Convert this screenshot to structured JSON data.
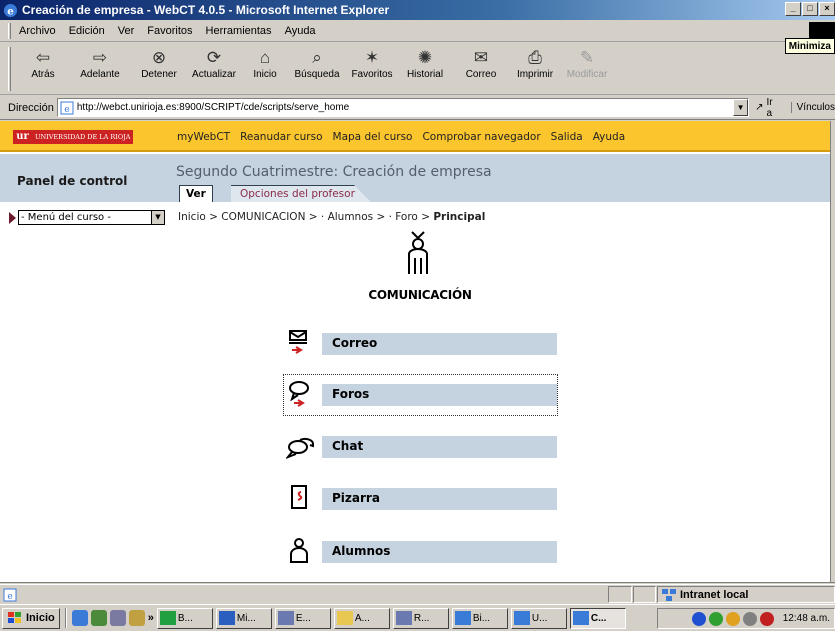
{
  "window": {
    "title": "Creación de empresa - WebCT 4.0.5 - Microsoft Internet Explorer",
    "controls": [
      "_",
      "□",
      "×"
    ]
  },
  "menubar": {
    "items": [
      "Archivo",
      "Edición",
      "Ver",
      "Favoritos",
      "Herramientas",
      "Ayuda"
    ],
    "tooltip": "Minimiza"
  },
  "toolbar": {
    "back": "Atrás",
    "forward": "Adelante",
    "stop": "Detener",
    "refresh": "Actualizar",
    "home": "Inicio",
    "search": "Búsqueda",
    "favorites": "Favoritos",
    "history": "Historial",
    "mail": "Correo",
    "print": "Imprimir",
    "edit": "Modificar"
  },
  "address": {
    "label": "Dirección",
    "url": "http://webct.unirioja.es:8900/SCRIPT/cde/scripts/serve_home",
    "go": "Ir a",
    "links": "Vínculos"
  },
  "webct": {
    "university": "UNIVERSIDAD DE LA RIOJA",
    "university_mark": "ur",
    "nav": [
      "myWebCT",
      "Reanudar curso",
      "Mapa del curso",
      "Comprobar navegador",
      "Salida",
      "Ayuda"
    ],
    "panel_title": "Panel de control",
    "course_title": "Segundo Cuatrimestre: Creación de empresa",
    "tabs": {
      "view": "Ver",
      "teacher": "Opciones del profesor"
    },
    "course_menu": "- Menú del curso -",
    "breadcrumb": {
      "path": "Inicio > COMUNICACION > · Alumnos > · Foro > ",
      "current": "Principal"
    },
    "section_title": "COMUNICACIÓN",
    "items": [
      {
        "label": "Correo",
        "icon": "mail-icon"
      },
      {
        "label": "Foros",
        "icon": "forum-icon"
      },
      {
        "label": "Chat",
        "icon": "chat-icon"
      },
      {
        "label": "Pizarra",
        "icon": "whiteboard-icon"
      },
      {
        "label": "Alumnos",
        "icon": "students-icon"
      }
    ]
  },
  "status": {
    "zone": "Intranet local"
  },
  "taskbar": {
    "start": "Inicio",
    "tasks": [
      "B...",
      "Mi...",
      "E...",
      "A...",
      "R...",
      "Bi...",
      "U...",
      "C..."
    ],
    "clock": "12:48 a.m."
  },
  "colors": {
    "accent_yellow": "#fbc52e",
    "panel_blue": "#c5d2e0",
    "titlebar": "#0a246a"
  }
}
